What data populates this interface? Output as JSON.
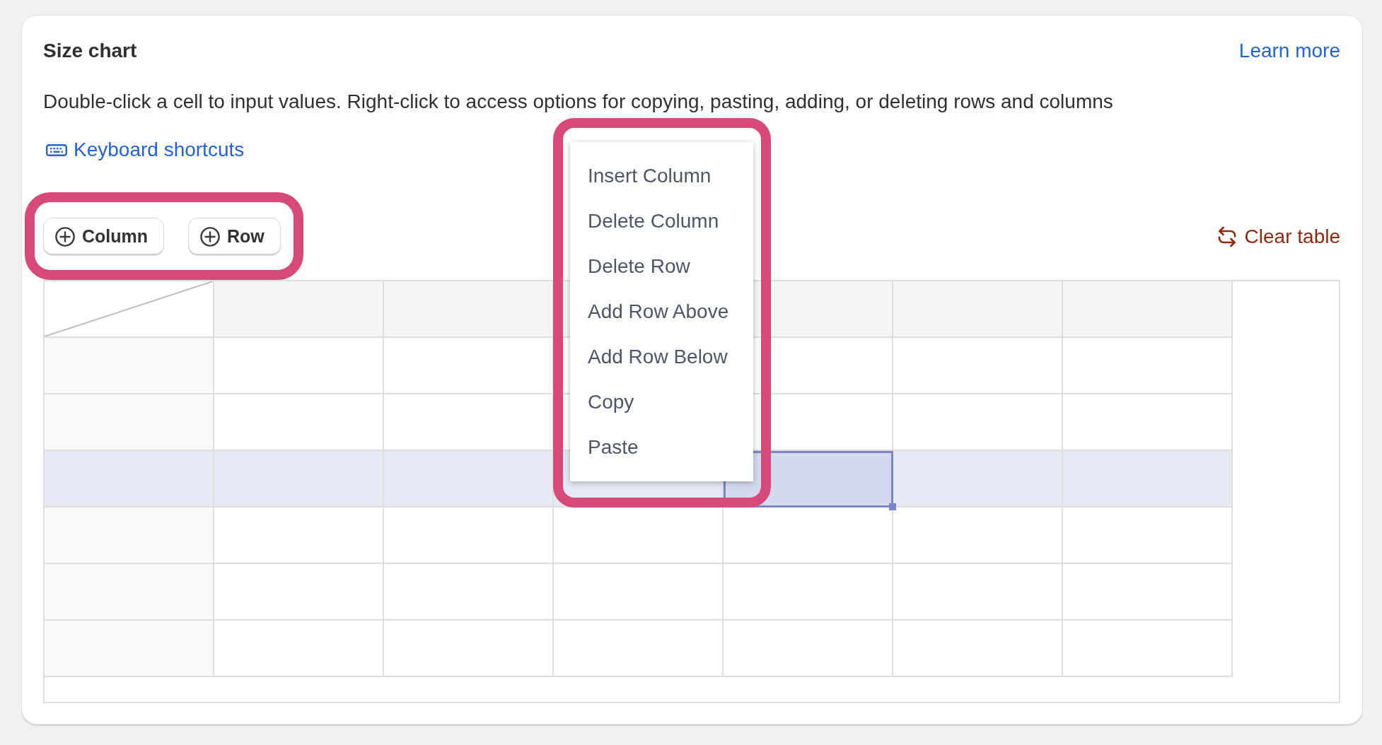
{
  "card": {
    "title": "Size chart",
    "link": "Learn more",
    "description": "Double-click a cell to input values. Right-click to access options for copying, pasting, adding, or deleting rows and columns",
    "shortcuts_link": "Keyboard shortcuts"
  },
  "toolbar": {
    "highlighted": true,
    "buttons": [
      "Column",
      "Row"
    ],
    "clear_button": "Clear table"
  },
  "table": {
    "rows": [
      {
        "selected": false,
        "cells": [
          {
            "selected": false
          },
          {
            "selected": false
          },
          {
            "selected": false
          },
          {
            "selected": false
          },
          {
            "selected": false
          },
          {
            "selected": false
          }
        ]
      },
      {
        "selected": false,
        "cells": [
          {
            "selected": false
          },
          {
            "selected": false
          },
          {
            "selected": false
          },
          {
            "selected": false
          },
          {
            "selected": false
          },
          {
            "selected": false
          }
        ]
      },
      {
        "selected": true,
        "cells": [
          {
            "selected": false
          },
          {
            "selected": false
          },
          {
            "selected": false
          },
          {
            "selected": true
          },
          {
            "selected": false
          },
          {
            "selected": false
          }
        ]
      },
      {
        "selected": false,
        "cells": [
          {
            "selected": false
          },
          {
            "selected": false
          },
          {
            "selected": false
          },
          {
            "selected": false
          },
          {
            "selected": false
          },
          {
            "selected": false
          }
        ]
      },
      {
        "selected": false,
        "cells": [
          {
            "selected": false
          },
          {
            "selected": false
          },
          {
            "selected": false
          },
          {
            "selected": false
          },
          {
            "selected": false
          },
          {
            "selected": false
          }
        ]
      },
      {
        "selected": false,
        "cells": [
          {
            "selected": false
          },
          {
            "selected": false
          },
          {
            "selected": false
          },
          {
            "selected": false
          },
          {
            "selected": false
          },
          {
            "selected": false
          }
        ]
      }
    ]
  },
  "context_menu": {
    "highlighted": true,
    "items": [
      "Insert Column",
      "Delete Column",
      "Delete Row",
      "Add Row Above",
      "Add Row Below",
      "Copy",
      "Paste"
    ]
  }
}
